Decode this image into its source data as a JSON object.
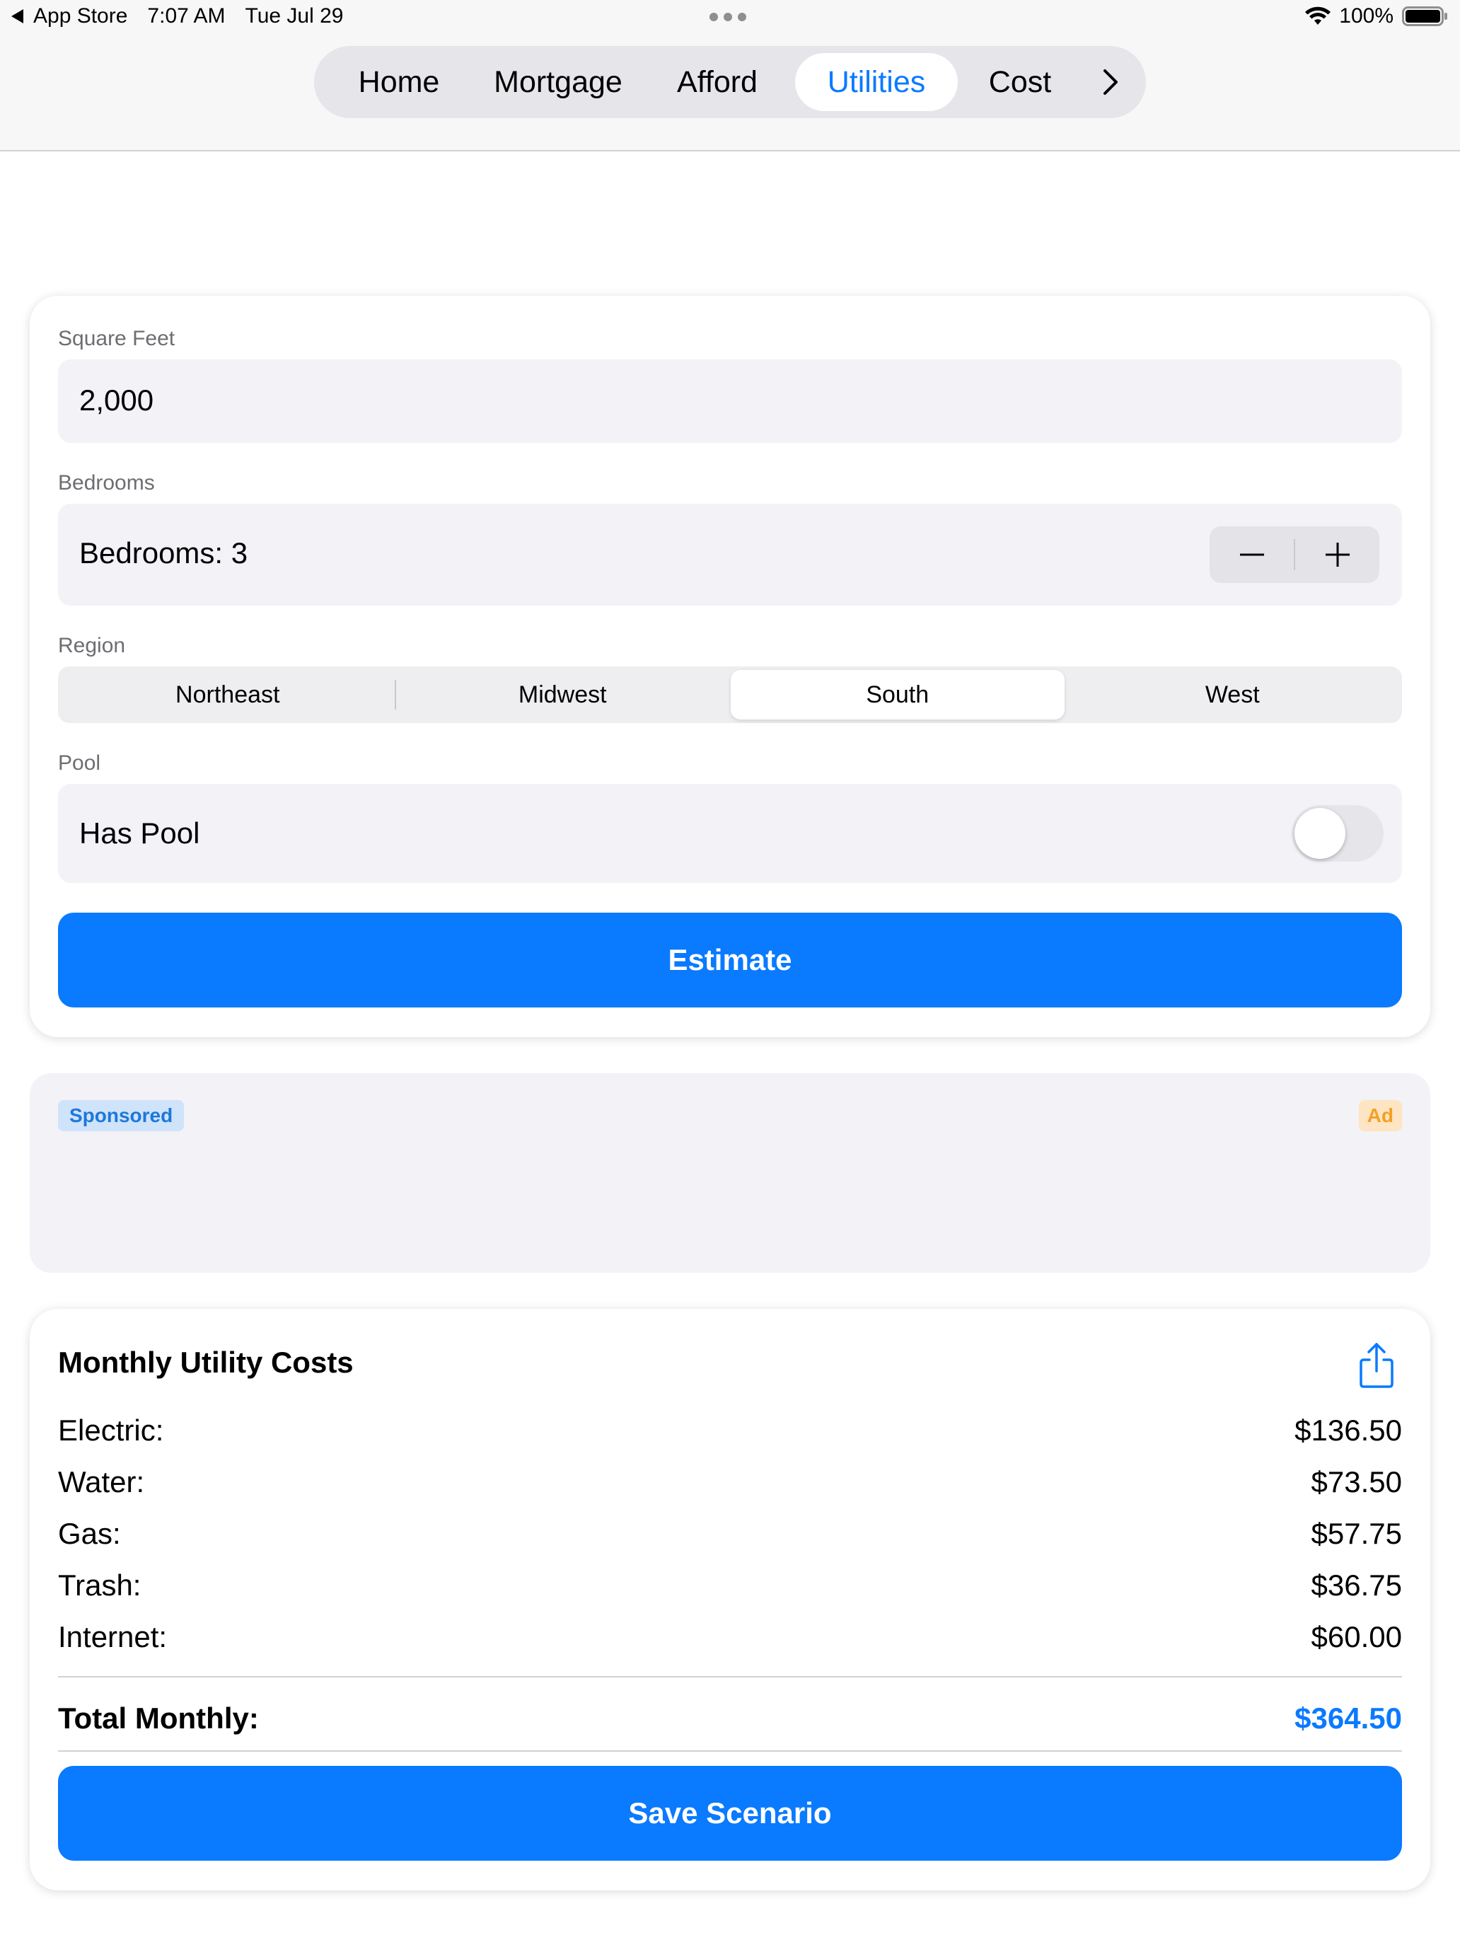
{
  "status_bar": {
    "back_app": "App Store",
    "time": "7:07 AM",
    "date": "Tue Jul 29",
    "battery": "100%"
  },
  "tabs": [
    {
      "label": "Home"
    },
    {
      "label": "Mortgage"
    },
    {
      "label": "Afford"
    },
    {
      "label": "Utilities",
      "active": true
    },
    {
      "label": "Cost"
    }
  ],
  "form": {
    "square_feet_label": "Square Feet",
    "square_feet_value": "2,000",
    "bedrooms_label": "Bedrooms",
    "bedrooms_text": "Bedrooms: 3",
    "region_label": "Region",
    "regions": [
      "Northeast",
      "Midwest",
      "South",
      "West"
    ],
    "selected_region": "South",
    "pool_label": "Pool",
    "pool_text": "Has Pool",
    "pool_on": false,
    "estimate_label": "Estimate"
  },
  "ad": {
    "sponsored": "Sponsored",
    "ad": "Ad"
  },
  "results": {
    "title": "Monthly Utility Costs",
    "rows": [
      {
        "label": "Electric:",
        "value": "$136.50"
      },
      {
        "label": "Water:",
        "value": "$73.50"
      },
      {
        "label": "Gas:",
        "value": "$57.75"
      },
      {
        "label": "Trash:",
        "value": "$36.75"
      },
      {
        "label": "Internet:",
        "value": "$60.00"
      }
    ],
    "total_label": "Total Monthly:",
    "total_value": "$364.50",
    "save_label": "Save Scenario"
  },
  "colors": {
    "accent": "#0a7aff",
    "sponsored_badge": "#cfe3fb",
    "ad_badge": "#fde5c3"
  }
}
